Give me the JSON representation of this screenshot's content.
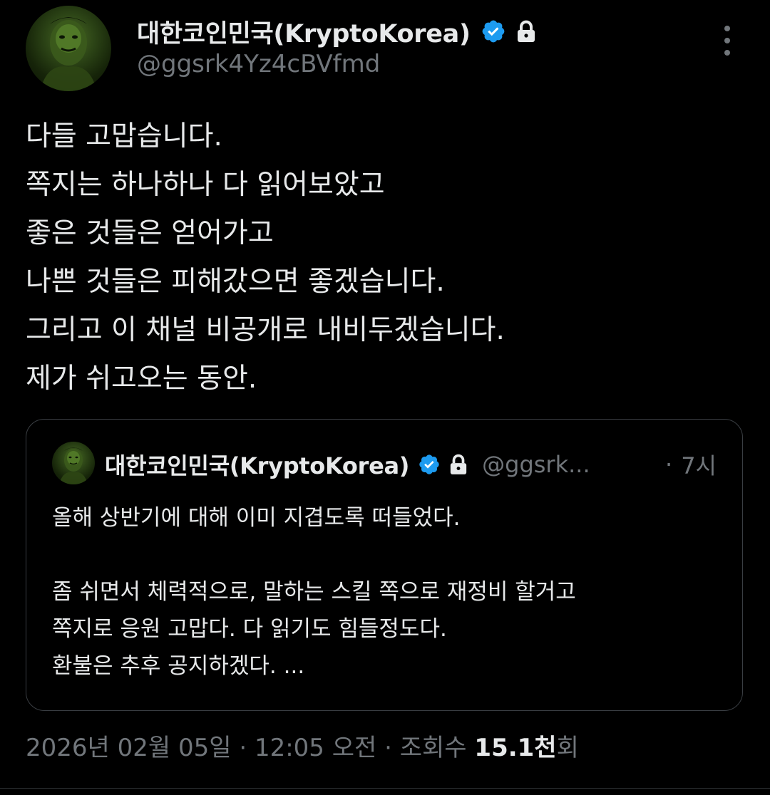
{
  "author": {
    "display_name": "대한코인민국(KryptoKorea)",
    "handle": "@ggsrk4Yz4cBVfmd",
    "verified": true,
    "protected": true,
    "avatar_icon": "hulk-avatar"
  },
  "tweet": {
    "lines": [
      "다들 고맙습니다.",
      "쪽지는 하나하나 다 읽어보았고",
      "좋은 것들은 얻어가고",
      "나쁜 것들은 피해갔으면 좋겠습니다.",
      "그리고 이 채널 비공개로 내비두겠습니다.",
      "제가 쉬고오는 동안."
    ]
  },
  "quoted": {
    "display_name": "대한코인민국(KryptoKorea)",
    "handle": "@ggsrk...",
    "separator": "·",
    "time": "7시",
    "lines": [
      "올해 상반기에 대해 이미 지겹도록 떠들었다.",
      "",
      "좀 쉬면서 체력적으로, 말하는 스킬 쪽으로 재정비 할거고",
      "쪽지로 응원 고맙다. 다 읽기도 힘들정도다.",
      "환불은 추후 공지하겠다. ..."
    ]
  },
  "meta": {
    "date": "2026년 02월 05일",
    "sep1": " · ",
    "time": "12:05 오전",
    "sep2": " · ",
    "views_label": "조회수 ",
    "views_count": "15.1천",
    "views_suffix": "회"
  },
  "colors": {
    "background": "#000000",
    "text_primary": "#e7e9ea",
    "text_secondary": "#71767b",
    "verified_blue": "#1d9bf0",
    "border": "#3a3e43"
  }
}
